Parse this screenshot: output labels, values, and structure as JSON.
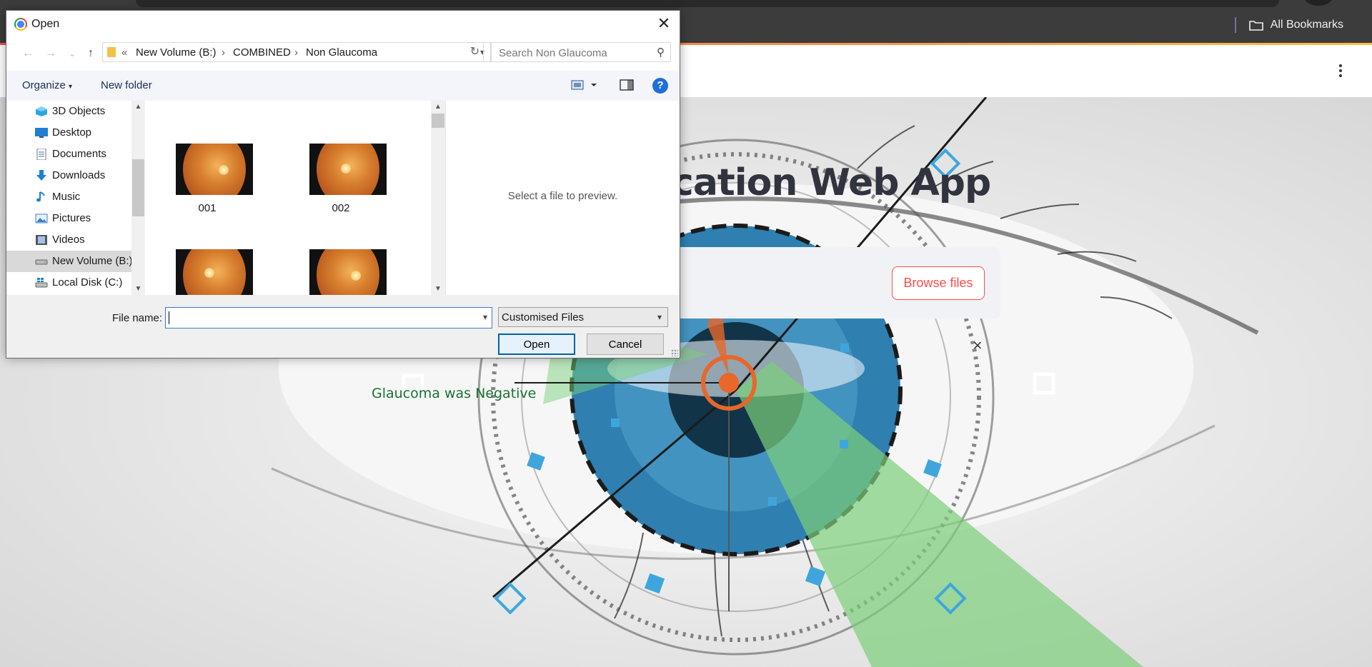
{
  "browser": {
    "bookmarks_label": "All Bookmarks"
  },
  "app": {
    "title": "cation Web App",
    "upload_button": "Browse files",
    "result_text": "Glaucoma was Negative",
    "close_symbol": "×",
    "result_color": "#177233",
    "accent_color": "#ff4b4b"
  },
  "dialog": {
    "title": "Open",
    "close_symbol": "✕",
    "nav": {
      "back": "←",
      "forward": "→",
      "recent": "⌄",
      "up": "↑"
    },
    "address": {
      "overflow": "«",
      "segments": [
        "New Volume (B:)",
        "COMBINED",
        "Non Glaucoma"
      ],
      "separator": "›"
    },
    "search_placeholder": "Search Non Glaucoma",
    "toolbar": {
      "organize": "Organize",
      "new_folder": "New folder",
      "help": "?"
    },
    "nav_items": [
      {
        "label": "3D Objects",
        "icon": "3d-objects-icon"
      },
      {
        "label": "Desktop",
        "icon": "desktop-icon"
      },
      {
        "label": "Documents",
        "icon": "documents-icon"
      },
      {
        "label": "Downloads",
        "icon": "downloads-icon"
      },
      {
        "label": "Music",
        "icon": "music-icon"
      },
      {
        "label": "Pictures",
        "icon": "pictures-icon"
      },
      {
        "label": "Videos",
        "icon": "videos-icon"
      },
      {
        "label": "New Volume (B:)",
        "icon": "drive-icon",
        "selected": true
      },
      {
        "label": "Local Disk (C:)",
        "icon": "windows-drive-icon"
      }
    ],
    "files": [
      {
        "name": "001"
      },
      {
        "name": "002"
      },
      {
        "name": ""
      },
      {
        "name": ""
      }
    ],
    "preview_message": "Select a file to preview.",
    "file_name_label": "File name:",
    "file_name_value": "",
    "file_type_selected": "Customised Files",
    "open_button": "Open",
    "cancel_button": "Cancel"
  }
}
